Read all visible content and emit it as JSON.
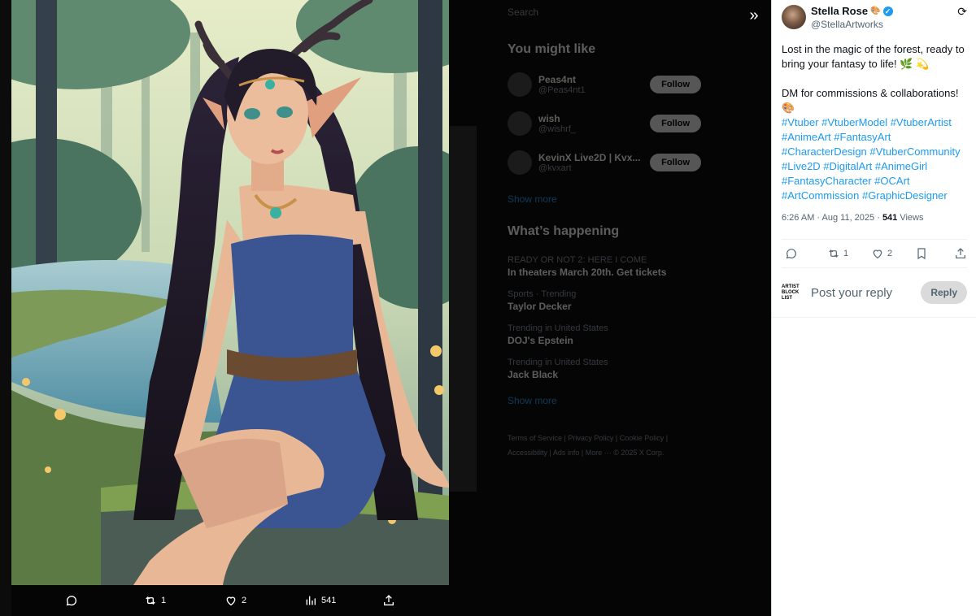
{
  "background_page": {
    "search_placeholder": "Search",
    "might_like_title": "You might like",
    "suggestions": [
      {
        "name": "Peas4nt",
        "handle": "@Peas4nt1",
        "follow": "Follow"
      },
      {
        "name": "wish",
        "handle": "@wishrf_",
        "follow": "Follow"
      },
      {
        "name": "KevinX Live2D | Kvx...",
        "handle": "@kvxart",
        "follow": "Follow"
      }
    ],
    "show_more": "Show more",
    "happening_title": "What’s happening",
    "trends": [
      {
        "context": "READY OR NOT 2: HERE I COME",
        "title": "In theaters March 20th. Get tickets"
      },
      {
        "context": "Sports · Trending",
        "title": "Taylor Decker"
      },
      {
        "context": "Trending in United States",
        "title": "DOJ's Epstein"
      },
      {
        "context": "Trending in United States",
        "title": "Jack Black"
      }
    ],
    "show_more_2": "Show more",
    "footer": "Terms of Service | Privacy Policy | Cookie Policy | Accessibility | Ads info | More ··· © 2025 X Corp."
  },
  "media_actions": {
    "retweets": "1",
    "likes": "2",
    "views": "541"
  },
  "tweet": {
    "author_name": "Stella Rose",
    "author_emoji": "🎨",
    "author_handle": "@StellaArtworks",
    "text_line1": "Lost in the magic of the forest, ready to bring your fantasy to life! 🌿 💫",
    "text_line2": "DM for commissions & collaborations! 🎨",
    "hashtags": "#Vtuber #VtuberModel #VtuberArtist #AnimeArt #FantasyArt #CharacterDesign #VtuberCommunity #Live2D #DigitalArt #AnimeGirl #FantasyCharacter #OCArt #ArtCommission #GraphicDesigner",
    "time": "6:26 AM · Aug 11, 2025 · ",
    "views_count": "541",
    "views_label": " Views",
    "retweets": "1",
    "likes": "2"
  },
  "reply": {
    "logo_text": "ARTIST BLOCK LIST",
    "placeholder": "Post your reply",
    "button": "Reply"
  },
  "colors": {
    "accent": "#1d9bf0",
    "dress": "#3a5592",
    "water": "#7db4c4"
  }
}
